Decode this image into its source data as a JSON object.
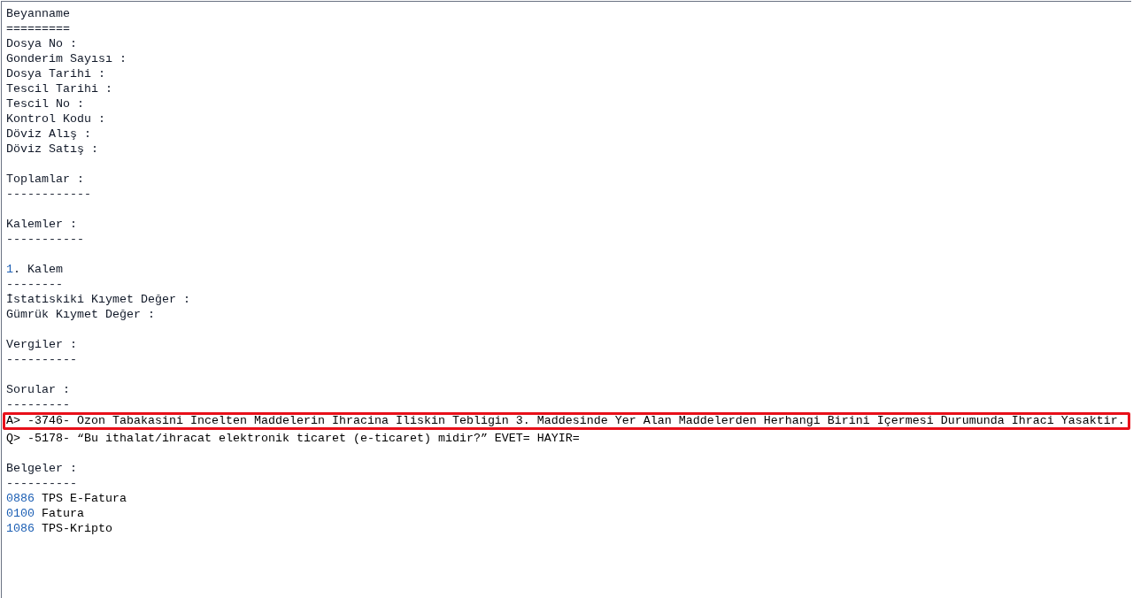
{
  "lines": [
    {
      "kind": "title",
      "text": "Beyanname"
    },
    {
      "kind": "rule",
      "text": "========="
    },
    {
      "kind": "field",
      "text": "Dosya No :"
    },
    {
      "kind": "field",
      "text": "Gonderim Sayısı :"
    },
    {
      "kind": "field",
      "text": "Dosya Tarihi :"
    },
    {
      "kind": "field",
      "text": "Tescil Tarihi :"
    },
    {
      "kind": "field",
      "text": "Tescil No :"
    },
    {
      "kind": "field",
      "text": "Kontrol Kodu :"
    },
    {
      "kind": "field",
      "text": "Döviz Alış :"
    },
    {
      "kind": "field",
      "text": "Döviz Satış :"
    },
    {
      "kind": "blank"
    },
    {
      "kind": "heading",
      "text": "Toplamlar :"
    },
    {
      "kind": "rule",
      "text": "------------"
    },
    {
      "kind": "blank"
    },
    {
      "kind": "heading",
      "text": "Kalemler :"
    },
    {
      "kind": "rule",
      "text": "-----------"
    },
    {
      "kind": "blank"
    },
    {
      "kind": "numbered",
      "number": "1",
      "text": ". Kalem"
    },
    {
      "kind": "rule",
      "text": "--------"
    },
    {
      "kind": "field",
      "text": "İstatiskiki Kıymet Değer :"
    },
    {
      "kind": "field",
      "text": "Gümrük Kıymet Değer :"
    },
    {
      "kind": "blank"
    },
    {
      "kind": "heading",
      "text": "Vergiler :"
    },
    {
      "kind": "rule",
      "text": "----------"
    },
    {
      "kind": "blank"
    },
    {
      "kind": "heading",
      "text": "Sorular :"
    },
    {
      "kind": "rule",
      "text": "---------"
    },
    {
      "kind": "question",
      "highlighted": true,
      "text": "A> -3746- Ozon Tabakasini Incelten Maddelerin Ihracina Iliskin Tebligin 3. Maddesinde Yer Alan Maddelerden Herhangi Birini Içermesi Durumunda Ihraci Yasaktir."
    },
    {
      "kind": "question",
      "highlighted": false,
      "text": "Q> -5178- “Bu ithalat/ihracat elektronik ticaret (e-ticaret) midir?” EVET= HAYIR="
    },
    {
      "kind": "blank"
    },
    {
      "kind": "heading",
      "text": "Belgeler :"
    },
    {
      "kind": "rule",
      "text": "----------"
    },
    {
      "kind": "document",
      "code": "0886",
      "text": "TPS E-Fatura"
    },
    {
      "kind": "document",
      "code": "0100",
      "text": "Fatura"
    },
    {
      "kind": "document",
      "code": "1086",
      "text": "TPS-Kripto"
    }
  ]
}
